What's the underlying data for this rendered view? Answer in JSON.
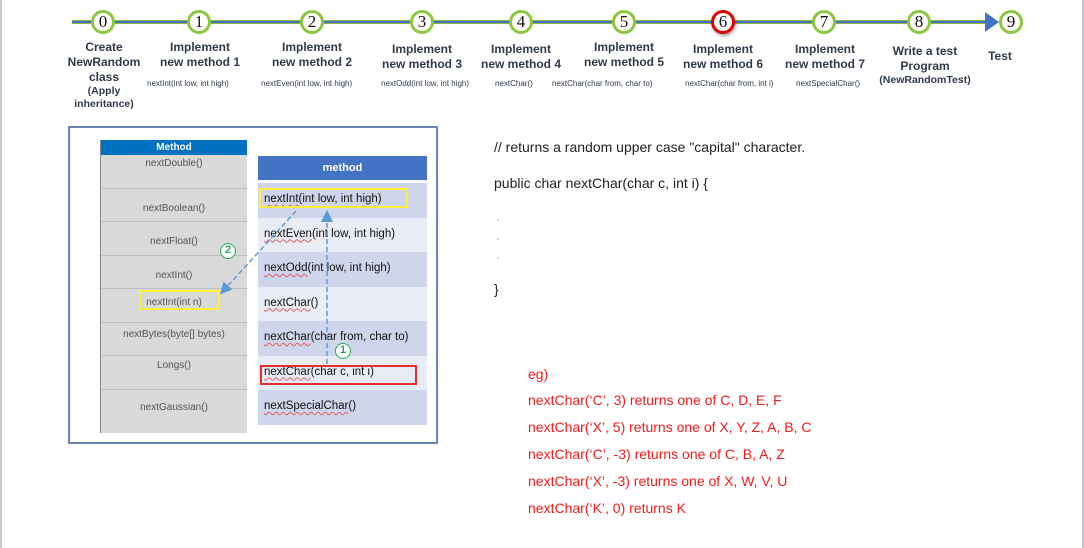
{
  "timeline": {
    "current_step": 6,
    "colors": {
      "line": "#4472c4",
      "ring": "#8dc63f",
      "active_ring": "#e00000"
    },
    "steps": [
      {
        "num": "0",
        "label_lines": [
          "Create",
          "NewRandom",
          "class"
        ],
        "note_lines": [
          "(Apply",
          "inheritance)"
        ],
        "method": ""
      },
      {
        "num": "1",
        "label_lines": [
          "Implement",
          "new method 1"
        ],
        "method": "nextInt(int low, int high)"
      },
      {
        "num": "2",
        "label_lines": [
          "Implement",
          "new method 2"
        ],
        "method": "nextEven(int low, int high)"
      },
      {
        "num": "3",
        "label_lines": [
          "Implement",
          "new method 3"
        ],
        "method": "nextOdd(int low, int high)"
      },
      {
        "num": "4",
        "label_lines": [
          "Implement",
          "new method 4"
        ],
        "method": "nextChar()"
      },
      {
        "num": "5",
        "label_lines": [
          "Implement",
          "new method 5"
        ],
        "method": "nextChar(char from, char to)"
      },
      {
        "num": "6",
        "label_lines": [
          "Implement",
          "new method 6"
        ],
        "method": "nextChar(char from, int i)"
      },
      {
        "num": "7",
        "label_lines": [
          "Implement",
          "new method 7"
        ],
        "method": "nextSpecialChar()"
      },
      {
        "num": "8",
        "label_lines": [
          "Write a test",
          "Program",
          "(NewRandomTest)"
        ],
        "method": ""
      },
      {
        "num": "9",
        "label_lines": [
          "Test"
        ],
        "method": ""
      }
    ]
  },
  "diagram": {
    "random_table": {
      "header": "Method",
      "rows": [
        "nextDouble()",
        "nextBoolean()",
        "nextFloat()",
        "nextInt()",
        "nextInt(int n)",
        "nextBytes(byte[] bytes)",
        "Longs()",
        "nextGaussian()"
      ]
    },
    "newrandom_table": {
      "header": "method",
      "rows": [
        {
          "name": "nextInt",
          "rest": "(int low, int high)"
        },
        {
          "name": "nextEven",
          "rest": "(int low, int high)"
        },
        {
          "name": "nextOdd",
          "rest": "(int low, int high)"
        },
        {
          "name": "nextChar",
          "rest": "()"
        },
        {
          "name": "nextChar",
          "rest": "(char from, char to)"
        },
        {
          "name": "nextChar",
          "rest": "(char c, int i)"
        },
        {
          "name": "nextSpecialChar",
          "rest": "()"
        }
      ]
    },
    "badges": [
      "1",
      "2"
    ]
  },
  "code": {
    "comment": "// returns a random upper case \"capital\" character.",
    "signature": "public char nextChar(char c, int i) {",
    "ellipsis": [
      ".",
      ".",
      "."
    ],
    "close": "}"
  },
  "examples": {
    "heading": "eg)",
    "lines": [
      "nextChar(‘C’, 3) returns one of C, D, E, F",
      "nextChar(‘X’, 5) returns one of X, Y, Z, A, B, C",
      "nextChar(‘C’, -3) returns one of C, B, A, Z",
      "nextChar(‘X’, -3) returns one of X, W, V, U",
      "nextChar(‘K’, 0) returns K"
    ],
    "color": "#ee1c1c"
  }
}
